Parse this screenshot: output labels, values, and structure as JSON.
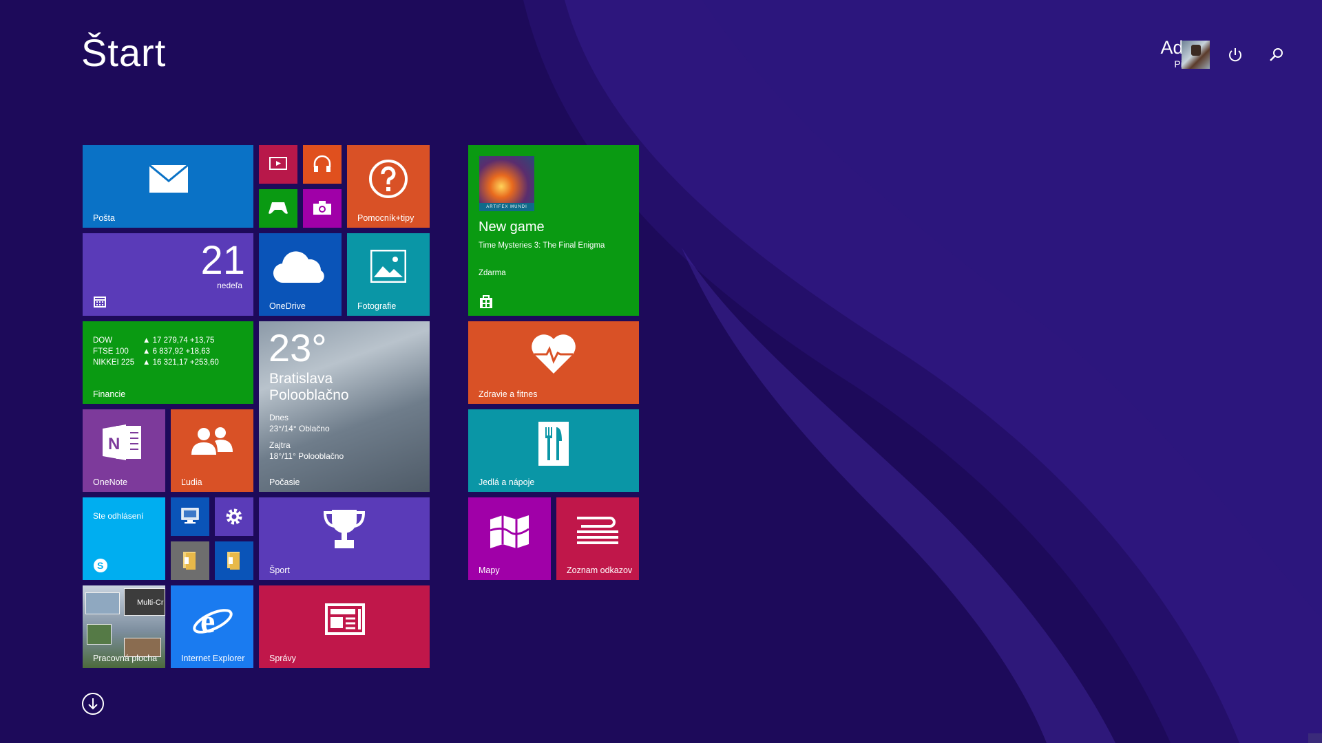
{
  "screen": {
    "title": "Štart"
  },
  "user": {
    "first_name": "Adam",
    "last_name": "Pivarník"
  },
  "tiles": {
    "mail": {
      "label": "Pošta"
    },
    "help": {
      "label": "Pomocník+tipy"
    },
    "calendar": {
      "day": "21",
      "weekday": "nedeľa"
    },
    "onedrive": {
      "label": "OneDrive"
    },
    "photos": {
      "label": "Fotografie"
    },
    "finance": {
      "label": "Financie",
      "rows": [
        {
          "name": "DOW",
          "value": "▲ 17 279,74 +13,75"
        },
        {
          "name": "FTSE 100",
          "value": "▲ 6 837,92 +18,63"
        },
        {
          "name": "NIKKEI 225",
          "value": "▲ 16 321,17 +253,60"
        }
      ]
    },
    "weather": {
      "label": "Počasie",
      "temp": "23°",
      "city": "Bratislava",
      "condition": "Polooblačno",
      "today_label": "Dnes",
      "today": "23°/14° Oblačno",
      "tomorrow_label": "Zajtra",
      "tomorrow": "18°/11° Polooblačno"
    },
    "onenote": {
      "label": "OneNote"
    },
    "people": {
      "label": "Ľudia"
    },
    "skype": {
      "text": "Ste odhlásení"
    },
    "sport": {
      "label": "Šport"
    },
    "desktop": {
      "label": "Pracovná plocha",
      "window_text": "Multi-Cr"
    },
    "ie": {
      "label": "Internet Explorer"
    },
    "news": {
      "label": "Správy"
    },
    "store": {
      "heading": "New game",
      "game": "Time Mysteries 3: The Final Enigma",
      "price": "Zdarma",
      "badge": "ARTIFEX MUNDI"
    },
    "health": {
      "label": "Zdravie a fitnes"
    },
    "food": {
      "label": "Jedlá a nápoje"
    },
    "maps": {
      "label": "Mapy"
    },
    "reading": {
      "label": "Zoznam odkazov"
    }
  },
  "colors": {
    "background": "#1d0a5a",
    "blue": "#0a72c6",
    "purple": "#5a3bb8",
    "green": "#0a9a12",
    "orange": "#d95126",
    "teal": "#0a96a6",
    "magenta": "#a000a8",
    "crimson": "#c0174a",
    "onenote": "#7d3a9b",
    "skype": "#00aef0"
  }
}
